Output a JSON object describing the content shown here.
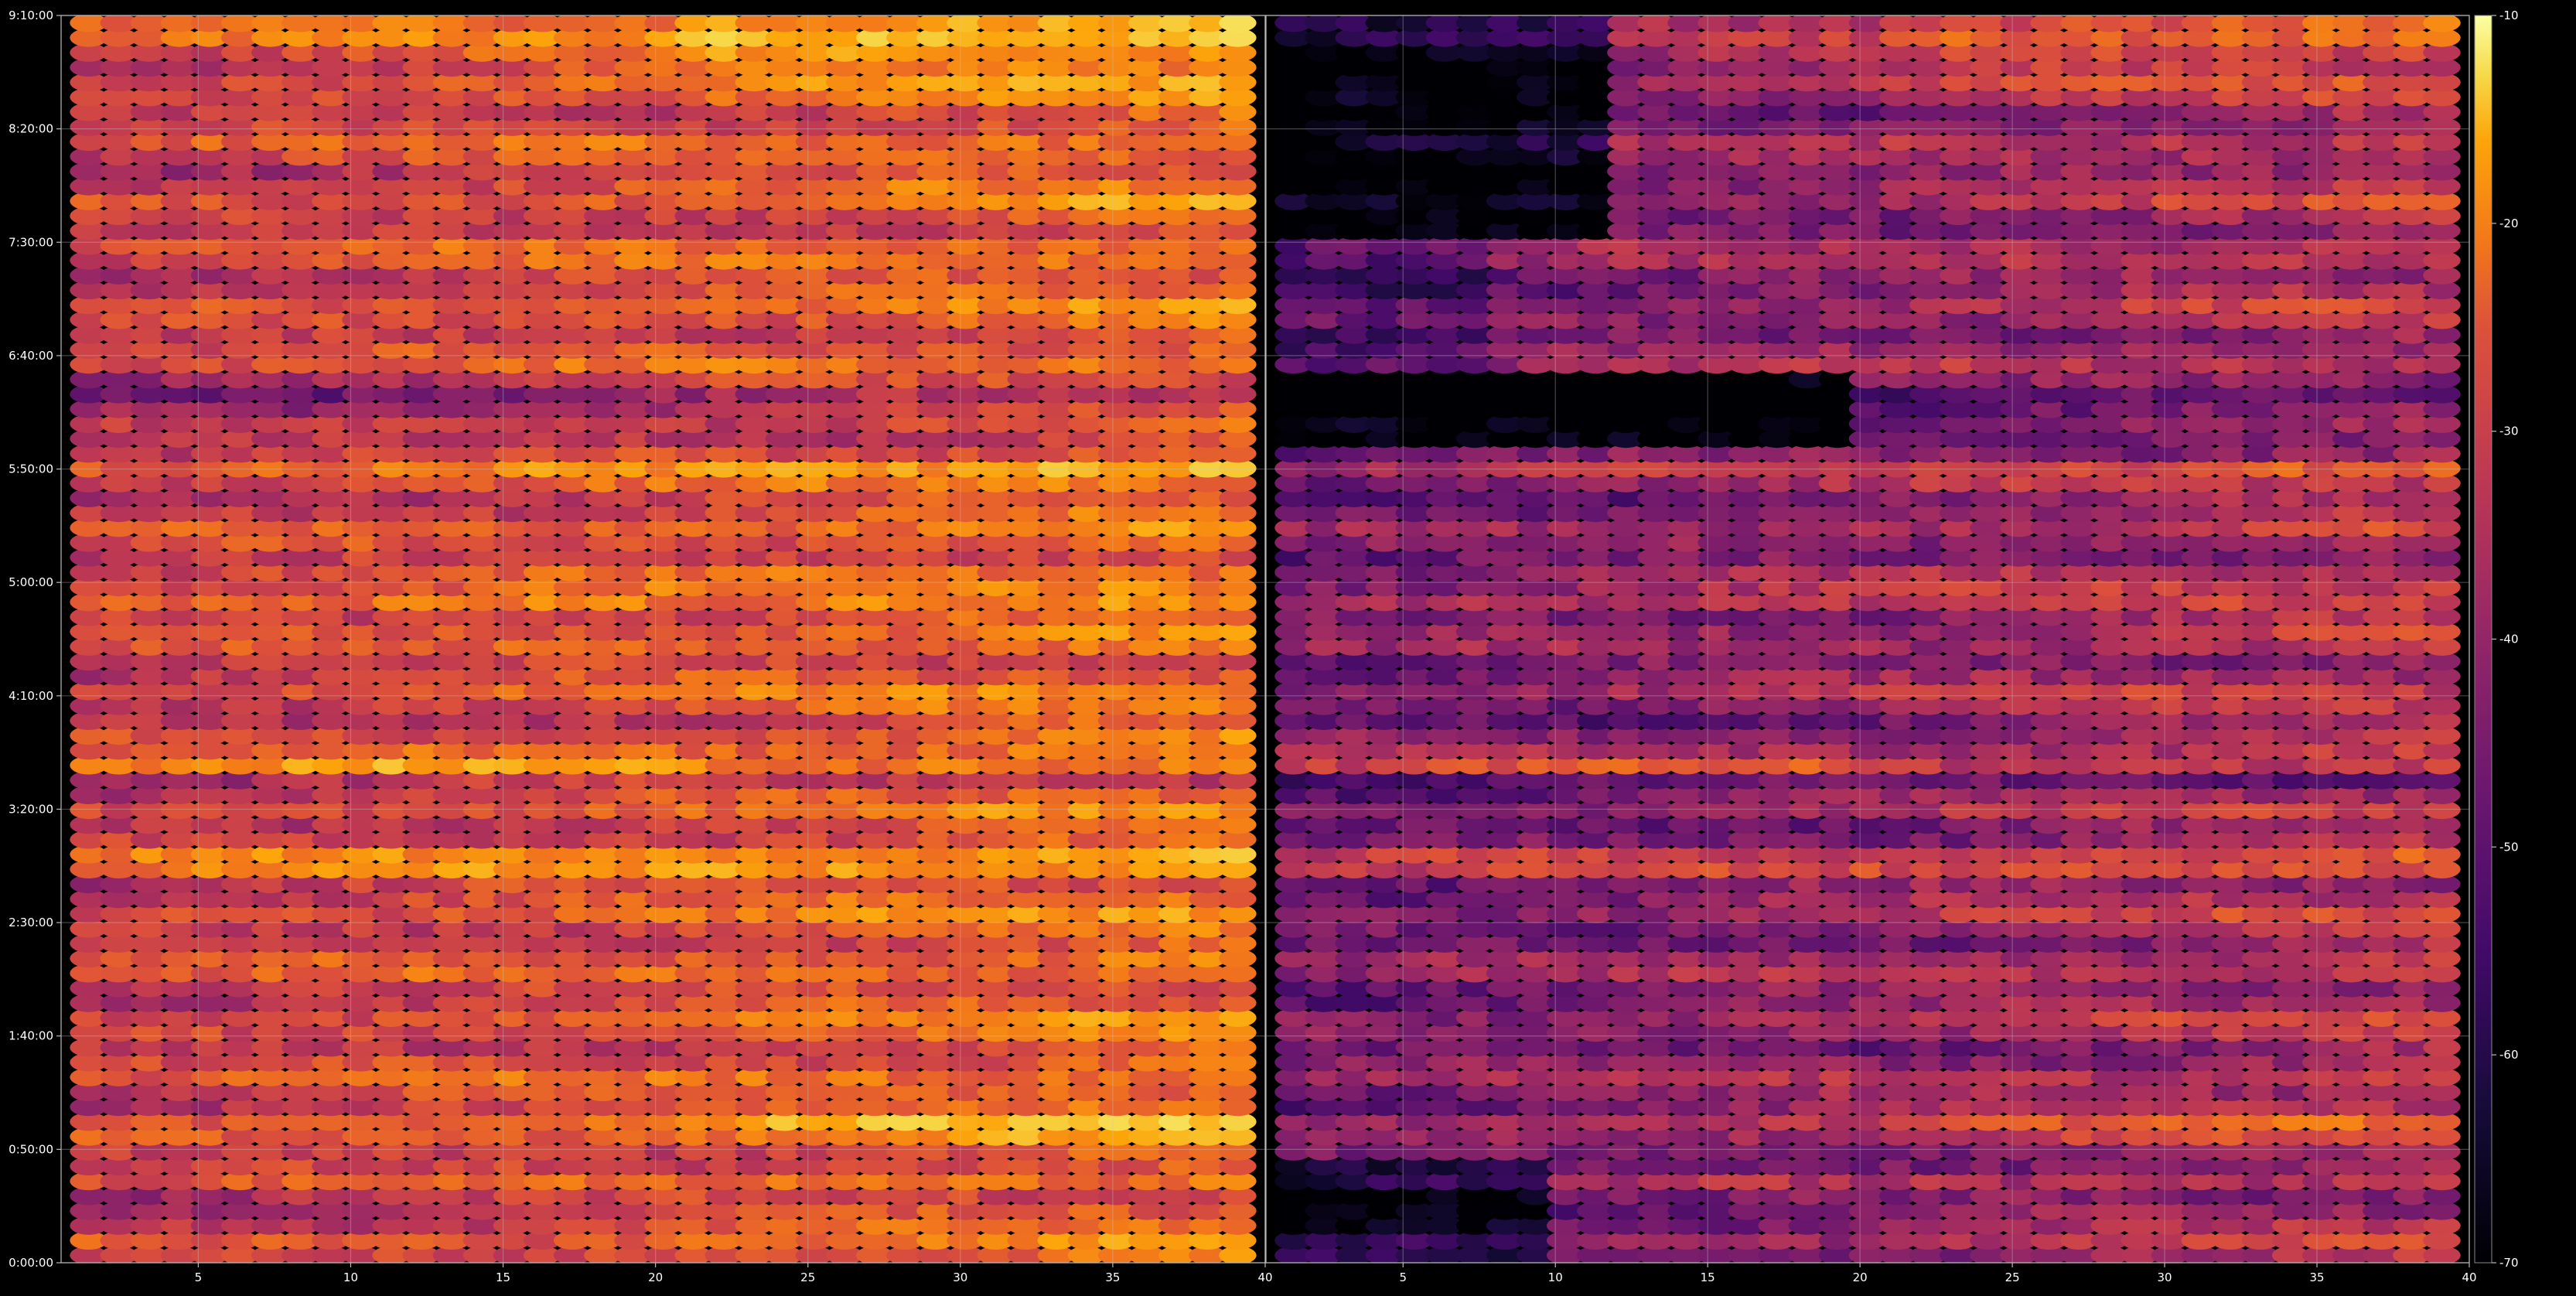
{
  "chart_data": {
    "type": "heatmap",
    "title": "",
    "panels": [
      {
        "name": "",
        "x_range": [
          1,
          40
        ],
        "x_ticks": [
          "5",
          "10",
          "15",
          "20",
          "25",
          "30",
          "35",
          "40"
        ],
        "x_tick_values": [
          5,
          10,
          15,
          20,
          25,
          30,
          35,
          40
        ],
        "dark_zone": false
      },
      {
        "name": "",
        "x_range": [
          1,
          40
        ],
        "x_ticks": [
          "5",
          "10",
          "15",
          "20",
          "25",
          "30",
          "35",
          "40"
        ],
        "x_tick_values": [
          5,
          10,
          15,
          20,
          25,
          30,
          35,
          40
        ],
        "dark_zone": true
      }
    ],
    "y_axis": {
      "label": "",
      "ticks": [
        "0:00:00",
        "0:50:00",
        "1:40:00",
        "2:30:00",
        "3:20:00",
        "4:10:00",
        "5:00:00",
        "5:50:00",
        "6:40:00",
        "7:30:00",
        "8:20:00",
        "9:10:00"
      ],
      "tick_seconds": [
        0,
        3000,
        6000,
        9000,
        12000,
        15000,
        18000,
        21000,
        24000,
        27000,
        30000,
        33000
      ],
      "range_seconds": [
        0,
        33000
      ]
    },
    "colorbar": {
      "colormap": "inferno",
      "range": [
        -70,
        -10
      ],
      "ticks": [
        "-10",
        "-20",
        "-30",
        "-40",
        "-50",
        "-60",
        "-70"
      ],
      "tick_values": [
        -10,
        -20,
        -30,
        -40,
        -50,
        -60,
        -70
      ]
    },
    "grid": true,
    "x_columns": 39,
    "y_rows": 84,
    "value_summary": {
      "typical_range": [
        -60,
        -15
      ],
      "hot_regions": [
        {
          "panel": 1,
          "x": [
            22,
            39
          ],
          "y_time": "8:00:00-9:10:00",
          "approx_value": -18
        },
        {
          "panel": 1,
          "x": [
            3,
            20
          ],
          "y_time": "3:40:00",
          "approx_value": -12
        },
        {
          "panel": 1,
          "x": [
            3,
            20
          ],
          "y_time": "4:50:00",
          "approx_value": -14
        },
        {
          "panel": 1,
          "x": [
            10,
            35
          ],
          "y_time": "2:55:00",
          "approx_value": -15
        },
        {
          "panel": 2,
          "x": [
            30,
            39
          ],
          "y_time": "5:50:00",
          "approx_value": -17
        }
      ],
      "cold_regions": [
        {
          "panel": 2,
          "x": [
            1,
            12
          ],
          "y_time": "7:40:00-9:10:00",
          "approx_value": -68
        },
        {
          "panel": 2,
          "x": [
            1,
            20
          ],
          "y_time": "6:05:00-6:35:00",
          "approx_value": -65
        },
        {
          "panel": 2,
          "x": [
            1,
            10
          ],
          "y_time": "0:00:00-0:45:00",
          "approx_value": -65
        }
      ]
    }
  }
}
